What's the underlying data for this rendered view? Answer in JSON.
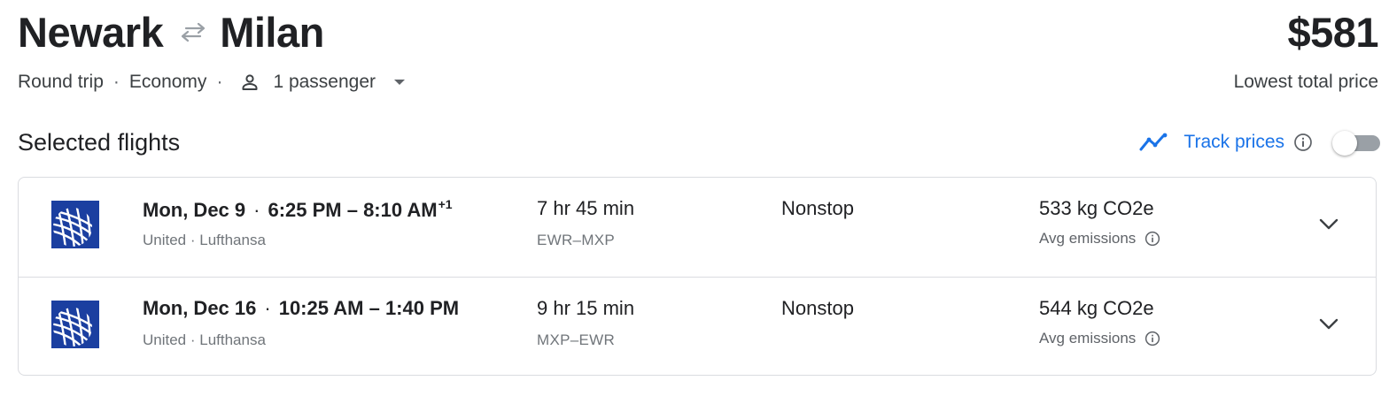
{
  "header": {
    "origin": "Newark",
    "destination": "Milan",
    "swap_icon": "swap-arrows-icon",
    "price": "$581",
    "price_caption": "Lowest total price"
  },
  "trip": {
    "type": "Round trip",
    "cabin": "Economy",
    "passengers": "1 passenger",
    "separator": "·"
  },
  "selected": {
    "title": "Selected flights",
    "track_label": "Track prices",
    "track_enabled": false
  },
  "flights": [
    {
      "date": "Mon, Dec 9",
      "dot": "·",
      "time_range": "6:25 PM – 8:10 AM",
      "day_offset": "+1",
      "airlines": "United · Lufthansa",
      "duration": "7 hr 45 min",
      "route": "EWR–MXP",
      "stops": "Nonstop",
      "emissions": "533 kg CO2e",
      "emissions_label": "Avg emissions"
    },
    {
      "date": "Mon, Dec 16",
      "dot": "·",
      "time_range": "10:25 AM – 1:40 PM",
      "day_offset": "",
      "airlines": "United · Lufthansa",
      "duration": "9 hr 15 min",
      "route": "MXP–EWR",
      "stops": "Nonstop",
      "emissions": "544 kg CO2e",
      "emissions_label": "Avg emissions"
    }
  ],
  "colors": {
    "accent": "#1a73e8",
    "united_blue": "#1b3fa0",
    "text": "#202124",
    "muted": "#70757a",
    "border": "#dadce0"
  }
}
